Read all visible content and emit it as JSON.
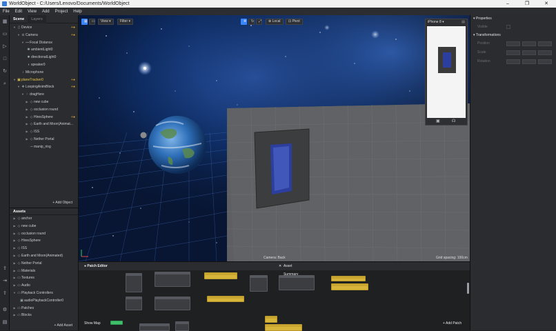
{
  "window": {
    "title": "WorldObject - C:/Users/Lenovo/Documents/WorldObject",
    "controls": [
      "–",
      "❐",
      "✕"
    ]
  },
  "menu": [
    "File",
    "Edit",
    "View",
    "Add",
    "Project",
    "Help"
  ],
  "scene": {
    "tabs": [
      "Scene",
      "Layers"
    ],
    "items": [
      {
        "label": "Device",
        "icon": "device-icon",
        "mark": "+●"
      },
      {
        "label": "Camera",
        "icon": "camera-icon",
        "mark": "+●"
      },
      {
        "label": "Focal Distance",
        "icon": "focal-distance-icon",
        "mark": ""
      },
      {
        "label": "ambientLight0",
        "icon": "ambient-light-icon",
        "mark": ""
      },
      {
        "label": "directionalLight0",
        "icon": "directional-light-icon",
        "mark": ""
      },
      {
        "label": "speaker0",
        "icon": "speaker-icon",
        "mark": ""
      },
      {
        "label": "Microphone",
        "icon": "microphone-icon",
        "mark": ""
      },
      {
        "label": "planeTracker0",
        "icon": "plane-tracker-icon",
        "mark": "+●"
      },
      {
        "label": "LoopingAnimBlock",
        "icon": "block-icon",
        "mark": "+●"
      },
      {
        "label": "dragHere",
        "icon": "null-object-icon",
        "mark": ""
      },
      {
        "label": "new cube",
        "icon": "object-icon",
        "mark": ""
      },
      {
        "label": "occlusion round",
        "icon": "object-icon",
        "mark": ""
      },
      {
        "label": "HiresSphere",
        "icon": "object-icon",
        "mark": "+●"
      },
      {
        "label": "Earth and Moon(Animat...",
        "icon": "object-icon",
        "mark": ""
      },
      {
        "label": "ISS",
        "icon": "object-icon",
        "mark": ""
      },
      {
        "label": "Nether Portal",
        "icon": "object-icon",
        "mark": ""
      },
      {
        "label": "manip_ring",
        "icon": "object-icon",
        "mark": ""
      }
    ],
    "add_label": "+ Add Object"
  },
  "assets": {
    "title": "Assets",
    "items": [
      {
        "label": "anchor",
        "icon": "object-icon"
      },
      {
        "label": "new cube",
        "icon": "object-icon"
      },
      {
        "label": "occlusion round",
        "icon": "object-icon"
      },
      {
        "label": "HiresSphere",
        "icon": "object-icon"
      },
      {
        "label": "ISS",
        "icon": "object-icon"
      },
      {
        "label": "Earth and Moon(Animated)",
        "icon": "object-icon"
      },
      {
        "label": "Nether Portal",
        "icon": "object-icon"
      },
      {
        "label": "Materials",
        "icon": "folder-icon"
      },
      {
        "label": "Textures",
        "icon": "folder-icon"
      },
      {
        "label": "Audio",
        "icon": "folder-icon"
      },
      {
        "label": "Playback Controllers",
        "icon": "folder-icon"
      },
      {
        "label": "audioPlaybackController0",
        "icon": "controller-icon"
      },
      {
        "label": "Patches",
        "icon": "folder-icon"
      },
      {
        "label": "Blocks",
        "icon": "folder-icon"
      }
    ],
    "add_label": "+ Add Asset"
  },
  "viewport": {
    "view_label": "View",
    "filter_label": "Filter",
    "local_label": "Local",
    "pivot_label": "Pivot",
    "device_label": "iPhone 8",
    "camera_label": "Camera: Back",
    "grid_label": "Grid spacing: 100cm"
  },
  "inspector": {
    "properties": "Properties",
    "visible": "Visible",
    "transformations": "Transformations",
    "position": "Position",
    "scale": "Scale",
    "rotation": "Rotation"
  },
  "patch": {
    "title": "Patch Editor",
    "asset_summary": "Asset Summary",
    "show_map": "Show Map",
    "add_patch": "+ Add Patch"
  },
  "colors": {
    "accent": "#3a86ff",
    "selection": "#e6c84a",
    "node_yellow": "#d6b53a",
    "node_green": "#3fbf6a"
  }
}
